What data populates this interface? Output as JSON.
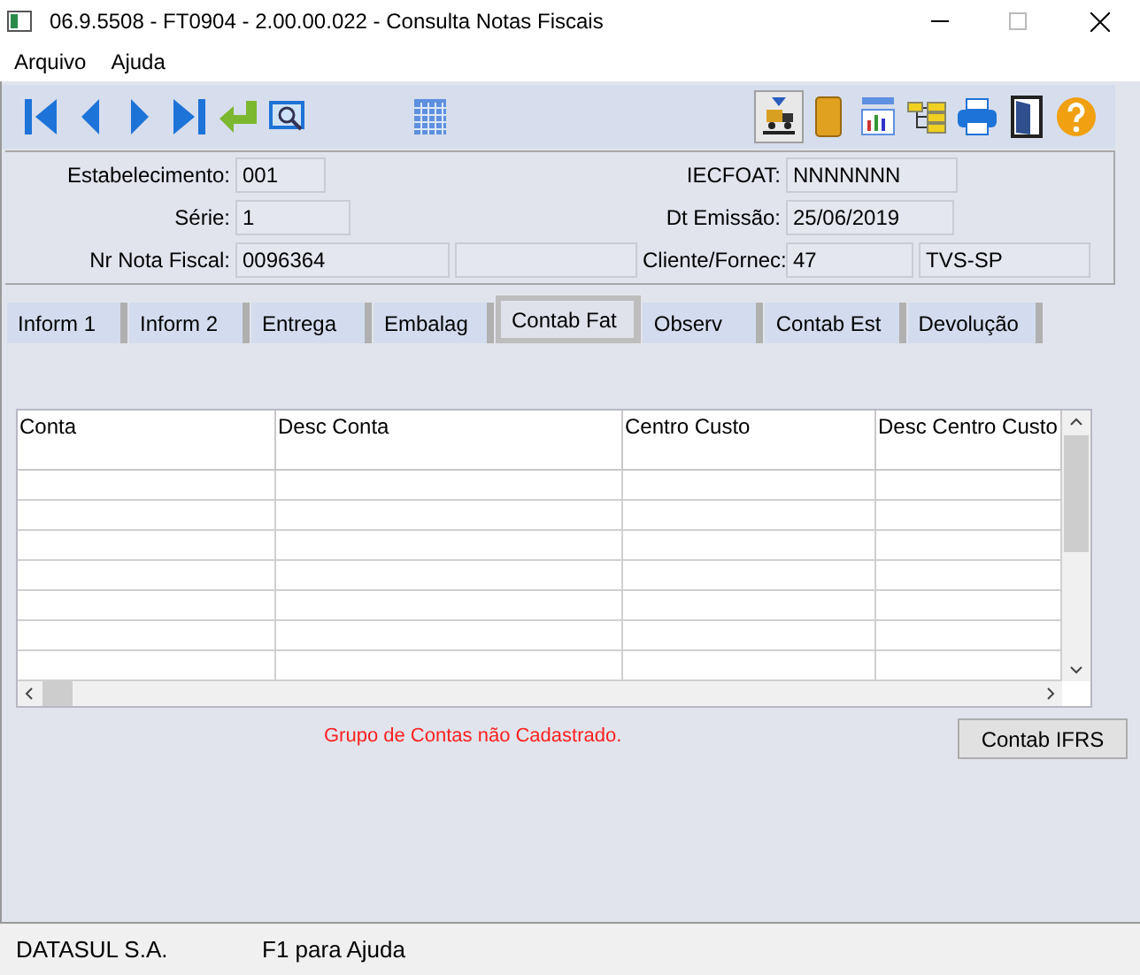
{
  "window": {
    "title": "06.9.5508 - FT0904 - 2.00.00.022 - Consulta Notas Fiscais"
  },
  "menu": [
    "Arquivo",
    "Ajuda"
  ],
  "toolbar_left": [
    {
      "kind": "first",
      "selected": false
    },
    {
      "kind": "prev",
      "selected": false
    },
    {
      "kind": "next",
      "selected": false
    },
    {
      "kind": "last",
      "selected": false
    },
    {
      "kind": "enter",
      "selected": false
    },
    {
      "kind": "zoom",
      "selected": false
    }
  ],
  "toolbar_mid": [
    {
      "kind": "calendar",
      "selected": false
    }
  ],
  "toolbar_right": [
    {
      "kind": "truck",
      "selected": true
    },
    {
      "kind": "book",
      "selected": false
    },
    {
      "kind": "chart",
      "selected": false
    },
    {
      "kind": "tree",
      "selected": false
    },
    {
      "kind": "printer",
      "selected": false
    },
    {
      "kind": "exit",
      "selected": false
    },
    {
      "kind": "help",
      "selected": false
    }
  ],
  "header_left": [
    {
      "label": "Estabelecimento:",
      "values": [
        "001"
      ]
    },
    {
      "label": "Série:",
      "values": [
        "1"
      ]
    },
    {
      "label": "Nr Nota Fiscal:",
      "values": [
        "0096364"
      ],
      "empty_field": true
    }
  ],
  "header_right": [
    {
      "label": "IECFOAT:",
      "values": [
        "NNNNNNN"
      ]
    },
    {
      "label": "Dt Emissão:",
      "values": [
        "25/06/2019"
      ]
    },
    {
      "label": "Cliente/Fornec:",
      "values": [
        "47",
        "TVS-SP"
      ]
    }
  ],
  "tabs": [
    {
      "label": "Inform 1",
      "selected": false
    },
    {
      "label": "Inform 2",
      "selected": false
    },
    {
      "label": "Entrega",
      "selected": false
    },
    {
      "label": "Embalag",
      "selected": false
    },
    {
      "label": "Contab Fat",
      "selected": true
    },
    {
      "label": "Observ",
      "selected": false
    },
    {
      "label": "Contab Est",
      "selected": false
    },
    {
      "label": "Devolução",
      "selected": false
    }
  ],
  "table": {
    "columns": [
      "Conta",
      "Desc Conta",
      "Centro Custo",
      "Desc Centro Custo"
    ]
  },
  "message": "Grupo de Contas não Cadastrado.",
  "button": "Contab IFRS",
  "status_bar": [
    "DATASUL S.A.",
    "F1 para Ajuda"
  ]
}
